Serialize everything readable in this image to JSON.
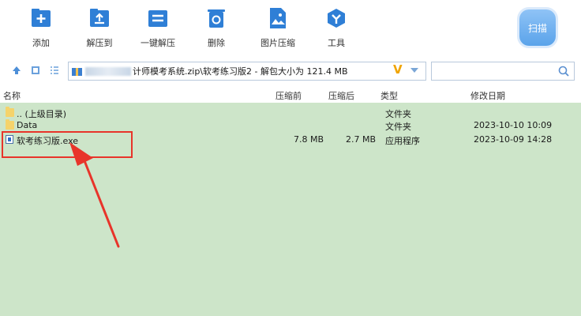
{
  "toolbar": {
    "buttons": [
      {
        "label": "添加",
        "icon": "add-icon"
      },
      {
        "label": "解压到",
        "icon": "extract-to-icon"
      },
      {
        "label": "一键解压",
        "icon": "one-click-extract-icon"
      },
      {
        "label": "删除",
        "icon": "trash-icon"
      },
      {
        "label": "图片压缩",
        "icon": "image-compress-icon"
      },
      {
        "label": "工具",
        "icon": "tools-icon"
      }
    ],
    "scan_label": "扫描"
  },
  "address": {
    "path_text": "计师模考系统.zip\\软考练习版2 - 解包大小为 121.4 MB",
    "v_badge": "V"
  },
  "columns": {
    "name": "名称",
    "before": "压缩前",
    "after": "压缩后",
    "type": "类型",
    "modified": "修改日期"
  },
  "rows": [
    {
      "name": ".. (上级目录)",
      "before": "",
      "after": "",
      "type": "文件夹",
      "modified": "",
      "kind": "folder"
    },
    {
      "name": "Data",
      "before": "",
      "after": "",
      "type": "文件夹",
      "modified": "2023-10-10 10:09",
      "kind": "folder"
    },
    {
      "name": "软考练习版.exe",
      "before": "7.8 MB",
      "after": "2.7 MB",
      "type": "应用程序",
      "modified": "2023-10-09 14:28",
      "kind": "exe"
    }
  ],
  "colors": {
    "list_bg": "#cde5c9",
    "icon_blue": "#2f7fd6",
    "highlight": "#e8342a",
    "accent_v": "#f0a400"
  }
}
